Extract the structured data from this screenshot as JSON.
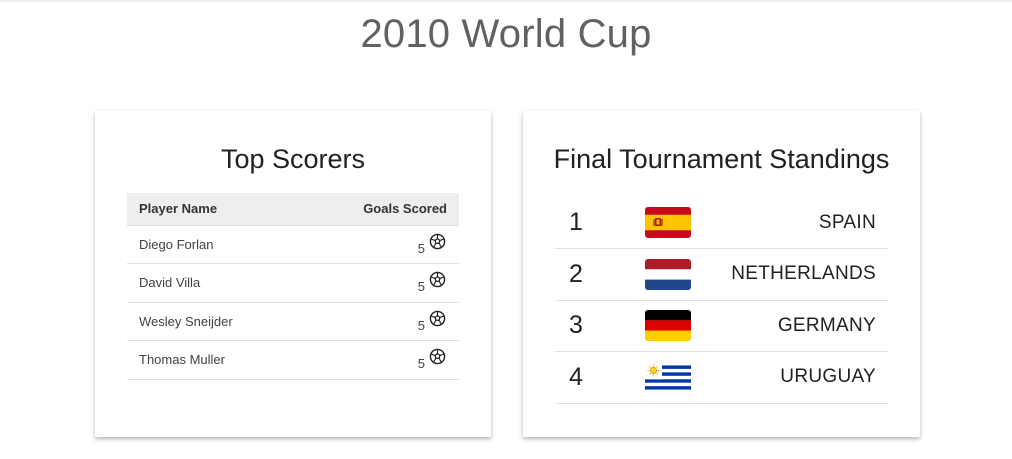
{
  "page": {
    "title": "2010 World Cup"
  },
  "scorers_card": {
    "title": "Top Scorers",
    "columns": [
      "Player Name",
      "Goals Scored"
    ],
    "rows": [
      {
        "player": "Diego Forlan",
        "goals": "5"
      },
      {
        "player": "David Villa",
        "goals": "5"
      },
      {
        "player": "Wesley Sneijder",
        "goals": "5"
      },
      {
        "player": "Thomas Muller",
        "goals": "5"
      }
    ],
    "goal_icon": "soccer-ball-icon"
  },
  "standings_card": {
    "title": "Final Tournament Standings",
    "rows": [
      {
        "rank": "1",
        "country": "SPAIN",
        "flag_icon": "spain-flag-icon"
      },
      {
        "rank": "2",
        "country": "NETHERLANDS",
        "flag_icon": "netherlands-flag-icon"
      },
      {
        "rank": "3",
        "country": "GERMANY",
        "flag_icon": "germany-flag-icon"
      },
      {
        "rank": "4",
        "country": "URUGUAY",
        "flag_icon": "uruguay-flag-icon"
      }
    ]
  },
  "colors": {
    "title_text": "#616161",
    "header_bg": "#eeeeee",
    "divider": "#e0e0e0"
  }
}
